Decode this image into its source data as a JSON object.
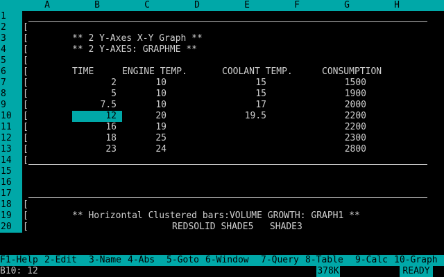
{
  "columns": [
    "A",
    "B",
    "C",
    "D",
    "E",
    "F",
    "G",
    "H"
  ],
  "rows": [
    "1",
    "2",
    "3",
    "4",
    "5",
    "6",
    "7",
    "8",
    "9",
    "10",
    "11",
    "12",
    "13",
    "14",
    "15",
    "16",
    "17",
    "18",
    "19",
    "20"
  ],
  "sheet": {
    "title1": "** 2 Y-Axes X-Y Graph **",
    "title2": "** 2 Y-AXES: GRAPHME **",
    "headers": [
      "TIME",
      "ENGINE TEMP.",
      "COOLANT TEMP.",
      "CONSUMPTION"
    ],
    "data": [
      [
        "2",
        "10",
        "15",
        "1500"
      ],
      [
        "5",
        "10",
        "15",
        "1900"
      ],
      [
        "7.5",
        "10",
        "17",
        "2000"
      ],
      [
        "12",
        "20",
        "19.5",
        "2200"
      ],
      [
        "16",
        "19",
        "",
        "2200"
      ],
      [
        "18",
        "25",
        "",
        "2300"
      ],
      [
        "23",
        "24",
        "",
        "2800"
      ]
    ],
    "graph_note": "** Horizontal Clustered bars:VOLUME GROWTH: GRAPH1 **",
    "shades": "REDSOLID SHADE5   SHADE3"
  },
  "bracket": "[",
  "fkeys": [
    "F1-Help",
    "2-Edit",
    "3-Name",
    "4-Abs",
    "5-Goto",
    "6-Window",
    "7-Query",
    "8-Table",
    "9-Calc",
    "10-Graph"
  ],
  "status": {
    "cell_ref": "B10: 12",
    "memory": "378K",
    "mode": "READY"
  }
}
